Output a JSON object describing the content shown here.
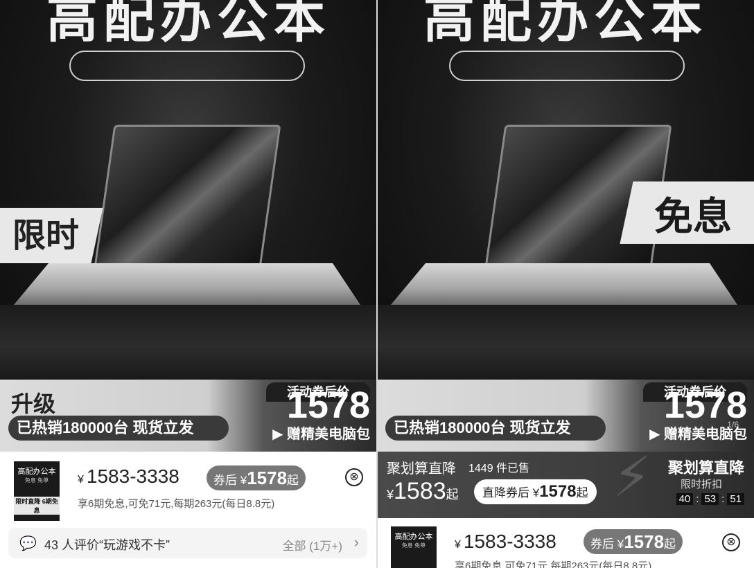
{
  "banner": {
    "title": "高配办公本",
    "limited": "限时",
    "interest_free": "免息"
  },
  "price_band": {
    "upgrade": "升级",
    "promo_label": "活动券后价",
    "price": "1578",
    "sold": "已热销180000台 现货立发",
    "gift": "▶ 赠精美电脑包",
    "page": "1/6"
  },
  "sku": {
    "thumb_title": "高配办公本",
    "thumb_sub": "免息 免单",
    "thumb_tag": "限时直降 6期免息",
    "currency": "¥",
    "range": "1583-3338",
    "after_label": "券后 ¥",
    "after_price": "1578",
    "after_suffix": "起",
    "close": "⊗",
    "installment": "享6期免息,可免71元,每期263元(每日8.8元)"
  },
  "review": {
    "text": "43 人评价“玩游戏不卡”",
    "all": "全部 (1万+)",
    "chevron": "›"
  },
  "juhuasuan": {
    "title": "聚划算直降",
    "sold": "1449 件已售",
    "currency": "¥",
    "price": "1583",
    "price_suffix": "起",
    "after_label": "直降券后 ¥",
    "after_price": "1578",
    "after_suffix": "起",
    "brand": "聚划算直降",
    "limit": "限时折扣",
    "timer": [
      "40",
      "53",
      "51"
    ]
  },
  "icons": [
    "close-icon",
    "comment-icon",
    "chevron-right-icon",
    "lightning-icon",
    "play-icon"
  ]
}
